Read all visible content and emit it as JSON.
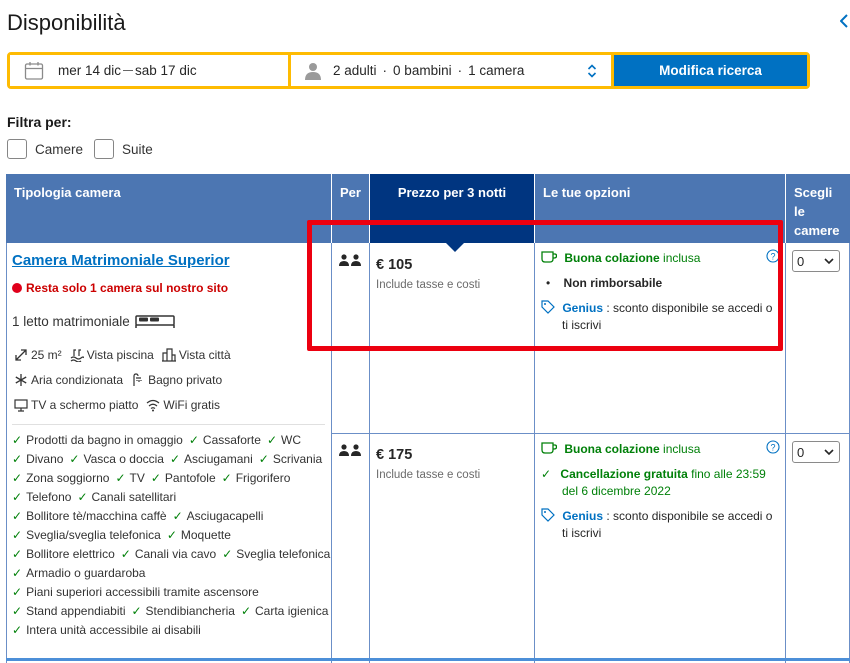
{
  "page": {
    "title": "Disponibilità"
  },
  "search": {
    "checkin": "mer 14 dic",
    "checkout": "sab 17 dic",
    "adults": "2 adulti",
    "children": "0 bambini",
    "rooms": "1 camera",
    "dot": "·",
    "button": "Modifica ricerca"
  },
  "filters": {
    "title": "Filtra per:",
    "options": [
      "Camere",
      "Suite"
    ]
  },
  "table": {
    "headers": {
      "room_type": "Tipologia camera",
      "per": "Per",
      "price": "Prezzo per 3 notti",
      "options": "Le tue opzioni",
      "choose_1": "Scegli",
      "choose_2": "le",
      "choose_3": "camere"
    },
    "room": {
      "name": "Camera Matrimoniale Superior",
      "availability": "Resta solo 1 camera sul nostro sito",
      "bed": "1 letto matrimoniale",
      "facilities_row1": [
        "25 m²",
        "Vista piscina",
        "Vista città"
      ],
      "facilities_row2": [
        "Aria condizionata",
        "Bagno privato"
      ],
      "facilities_row3": [
        "TV a schermo piatto",
        "WiFi gratis"
      ],
      "amenities": [
        [
          "Prodotti da bagno in omaggio",
          "Cassaforte",
          "WC"
        ],
        [
          "Divano",
          "Vasca o doccia",
          "Asciugamani",
          "Scrivania"
        ],
        [
          "Zona soggiorno",
          "TV",
          "Pantofole",
          "Frigorifero"
        ],
        [
          "Telefono",
          "Canali satellitari"
        ],
        [
          "Bollitore tè/macchina caffè",
          "Asciugacapelli"
        ],
        [
          "Sveglia/sveglia telefonica",
          "Moquette"
        ],
        [
          "Bollitore elettrico",
          "Canali via cavo",
          "Sveglia telefonica"
        ],
        [
          "Armadio o guardaroba"
        ],
        [
          "Piani superiori accessibili tramite ascensore"
        ],
        [
          "Stand appendiabiti",
          "Stendibiancheria",
          "Carta igienica"
        ],
        [
          "Intera unità accessibile ai disabili"
        ]
      ]
    },
    "offers": [
      {
        "price": "€ 105",
        "price_note": "Include tasse e costi",
        "breakfast": "Buona colazione",
        "breakfast_suffix": "inclusa",
        "policy": "Non rimborsabile",
        "genius": "Genius",
        "genius_text": ": sconto disponibile se accedi o",
        "genius_text2": "ti iscrivi",
        "select_value": "0"
      },
      {
        "price": "€ 175",
        "price_note": "Include tasse e costi",
        "breakfast": "Buona colazione",
        "breakfast_suffix": "inclusa",
        "cancel": "Cancellazione gratuita",
        "cancel_suffix": "fino alle 23:59",
        "cancel_date": "del 6 dicembre 2022",
        "genius": "Genius",
        "genius_text": ": sconto disponibile se accedi o",
        "genius_text2": "ti iscrivi",
        "select_value": "0"
      }
    ]
  },
  "colors": {
    "header_blue": "#4c76b2",
    "price_header": "#003580",
    "button_blue": "#0071c2",
    "search_border": "#febb02",
    "highlight_red": "#ec0010",
    "green": "#008009"
  }
}
